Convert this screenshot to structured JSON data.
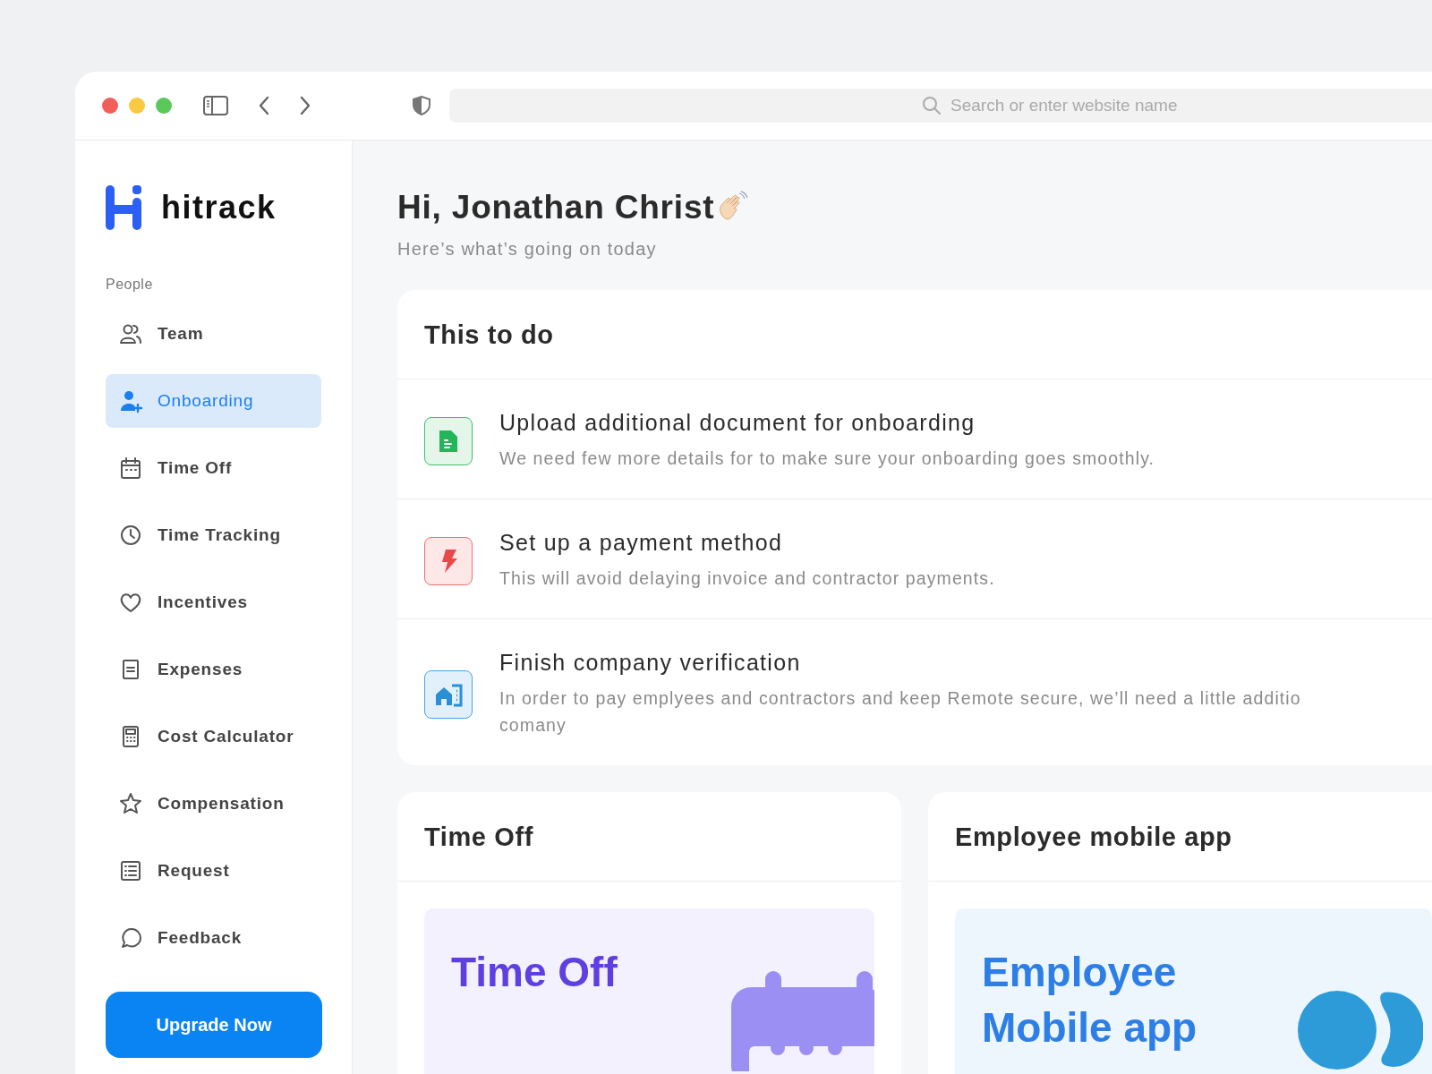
{
  "browser": {
    "search_placeholder": "Search or enter website name"
  },
  "sidebar": {
    "logo": "hitrack",
    "section": "People",
    "items": [
      {
        "label": "Team",
        "kind": "team",
        "selected": false
      },
      {
        "label": "Onboarding",
        "kind": "onboarding",
        "selected": true
      },
      {
        "label": "Time Off",
        "kind": "time-off",
        "selected": false
      },
      {
        "label": "Time Tracking",
        "kind": "tracking",
        "selected": false
      },
      {
        "label": "Incentives",
        "kind": "incentives",
        "selected": false
      },
      {
        "label": "Expenses",
        "kind": "expenses",
        "selected": false
      },
      {
        "label": "Cost Calculator",
        "kind": "calculator",
        "selected": false
      },
      {
        "label": "Compensation",
        "kind": "compensation",
        "selected": false
      },
      {
        "label": "Request",
        "kind": "request",
        "selected": false
      },
      {
        "label": "Feedback",
        "kind": "feedback",
        "selected": false
      }
    ],
    "upgrade_button": "Upgrade Now"
  },
  "greeting": {
    "title": "Hi, Jonathan Christ",
    "subtitle": "Here’s what’s going on today"
  },
  "todo": {
    "title": "This to do",
    "tasks": [
      {
        "kind": "document",
        "title": "Upload additional document for onboarding",
        "lines": [
          "We need few more details for to make sure your onboarding goes smoothly."
        ]
      },
      {
        "kind": "payment",
        "title": "Set up a payment method",
        "lines": [
          "This will avoid delaying invoice and contractor payments."
        ]
      },
      {
        "kind": "building",
        "title": "Finish company verification",
        "lines": [
          "In order to pay emplyees and contractors and keep Remote secure, we’ll need a little additio",
          "comany"
        ]
      }
    ]
  },
  "cards": [
    {
      "kind": "time-off",
      "title": "Time Off",
      "banner": [
        "Time Off"
      ]
    },
    {
      "kind": "mobile-app",
      "title": "Employee mobile app",
      "banner": [
        "Employee",
        "Mobile app"
      ]
    }
  ]
}
